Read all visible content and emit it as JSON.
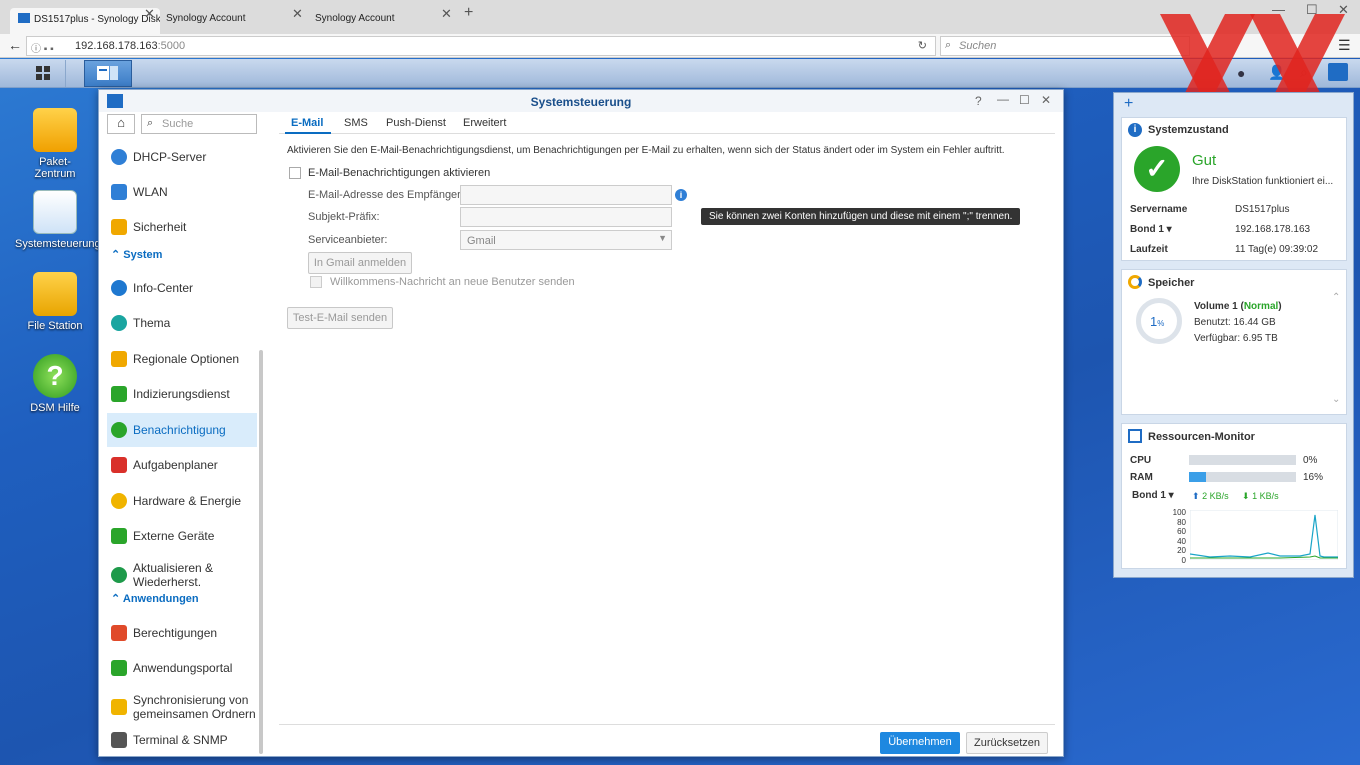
{
  "browser": {
    "tabs": [
      {
        "label": "DS1517plus - Synology Disk"
      },
      {
        "label": "Synology Account"
      },
      {
        "label": "Synology Account"
      }
    ],
    "url_host": "192.168.178.163",
    "url_port": ":5000",
    "search_placeholder": "Suchen"
  },
  "desktop": {
    "icons": [
      {
        "label": "Paket-\nZentrum"
      },
      {
        "label": "Systemsteuerung"
      },
      {
        "label": "File Station"
      },
      {
        "label": "DSM Hilfe"
      }
    ]
  },
  "window": {
    "title": "Systemsteuerung",
    "search_placeholder": "Suche",
    "nav": [
      {
        "label": "DHCP-Server",
        "color": "#2f7fd6"
      },
      {
        "label": "WLAN",
        "color": "#2f7fd6"
      },
      {
        "label": "Sicherheit",
        "color": "#f0a800"
      }
    ],
    "section_system": "System",
    "nav_system": [
      {
        "label": "Info-Center",
        "color": "#1e78d0"
      },
      {
        "label": "Thema",
        "color": "#1aa5a0"
      },
      {
        "label": "Regionale Optionen",
        "color": "#f0a800"
      },
      {
        "label": "Indizierungsdienst",
        "color": "#2aa52a"
      },
      {
        "label": "Benachrichtigung",
        "color": "#2aa52a"
      },
      {
        "label": "Aufgabenplaner",
        "color": "#d9302a"
      },
      {
        "label": "Hardware & Energie",
        "color": "#f0b400"
      },
      {
        "label": "Externe Geräte",
        "color": "#2aa52a"
      },
      {
        "label": "Aktualisieren &\nWiederherst.",
        "color": "#1e9a4a"
      }
    ],
    "section_apps": "Anwendungen",
    "nav_apps": [
      {
        "label": "Berechtigungen",
        "color": "#e04a2a"
      },
      {
        "label": "Anwendungsportal",
        "color": "#2aa52a"
      },
      {
        "label": "Synchronisierung von\ngemeinsamen Ordnern",
        "color": "#f0b400"
      },
      {
        "label": "Terminal & SNMP",
        "color": "#555555"
      }
    ],
    "tabs": [
      {
        "label": "E-Mail"
      },
      {
        "label": "SMS"
      },
      {
        "label": "Push-Dienst"
      },
      {
        "label": "Erweitert"
      }
    ],
    "description": "Aktivieren Sie den E-Mail-Benachrichtigungsdienst, um Benachrichtigungen per E-Mail zu erhalten, wenn sich der Status ändert oder im System ein Fehler auftritt.",
    "enable_label": "E-Mail-Benachrichtigungen aktivieren",
    "recipient_label": "E-Mail-Adresse des Empfängers:",
    "subject_label": "Subjekt-Präfix:",
    "provider_label": "Serviceanbieter:",
    "provider_value": "Gmail",
    "gmail_login": "In Gmail anmelden",
    "welcome_label": "Willkommens-Nachricht an neue Benutzer senden",
    "test_button": "Test-E-Mail senden",
    "tooltip": "Sie können zwei Konten hinzufügen und diese mit einem \";\" trennen.",
    "apply": "Übernehmen",
    "reset": "Zurücksetzen"
  },
  "widgets": {
    "health": {
      "title": "Systemzustand",
      "status": "Gut",
      "message": "Ihre DiskStation funktioniert ei...",
      "server_label": "Servername",
      "server_value": "DS1517plus",
      "bond_label": "Bond 1",
      "bond_value": "192.168.178.163",
      "uptime_label": "Laufzeit",
      "uptime_value": "11 Tag(e) 09:39:02"
    },
    "storage": {
      "title": "Speicher",
      "percent": "1",
      "percent_unit": "%",
      "volume": "Volume 1",
      "volume_status": "Normal",
      "used": "Benutzt: 16.44 GB",
      "free": "Verfügbar: 6.95 TB"
    },
    "monitor": {
      "title": "Ressourcen-Monitor",
      "cpu_label": "CPU",
      "cpu_value": "0%",
      "cpu_fraction": 0,
      "ram_label": "RAM",
      "ram_value": "16%",
      "ram_fraction": 0.16,
      "bond_label": "Bond 1",
      "up": "2 KB/s",
      "down": "1 KB/s",
      "ticks": [
        "100",
        "80",
        "60",
        "40",
        "20",
        "0"
      ]
    }
  }
}
